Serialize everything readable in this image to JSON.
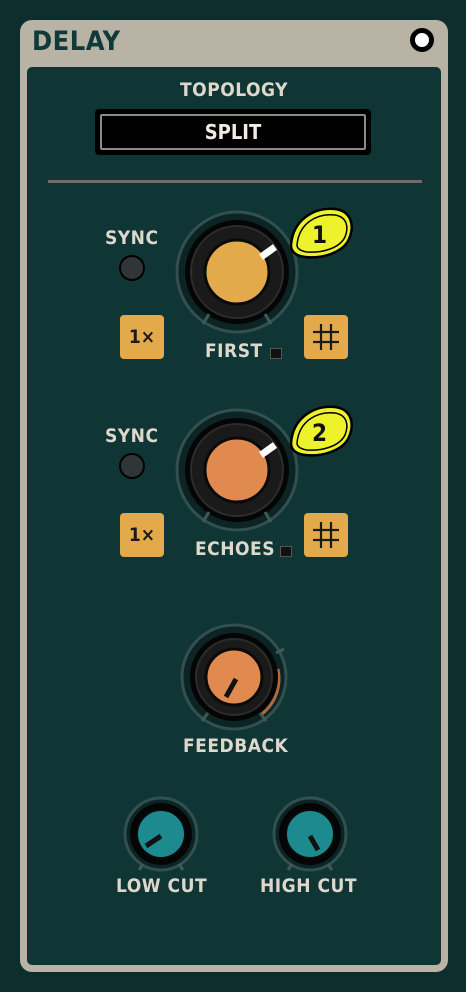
{
  "module": {
    "title": "DELAY"
  },
  "topology": {
    "label": "TOPOLOGY",
    "value": "SPLIT"
  },
  "first": {
    "sync_label": "SYNC",
    "mult_label": "1×",
    "label": "FIRST",
    "badge": "1"
  },
  "echoes": {
    "sync_label": "SYNC",
    "mult_label": "1×",
    "label": "ECHOES",
    "badge": "2"
  },
  "feedback": {
    "label": "FEEDBACK"
  },
  "low_cut": {
    "label": "LOW CUT"
  },
  "high_cut": {
    "label": "HIGH CUT"
  },
  "colors": {
    "accent_yellow": "#eef22a",
    "knob_gold": "#e3aa4c",
    "knob_orange": "#e08a50",
    "knob_teal": "#1c8a8e",
    "panel": "#0f3535"
  }
}
